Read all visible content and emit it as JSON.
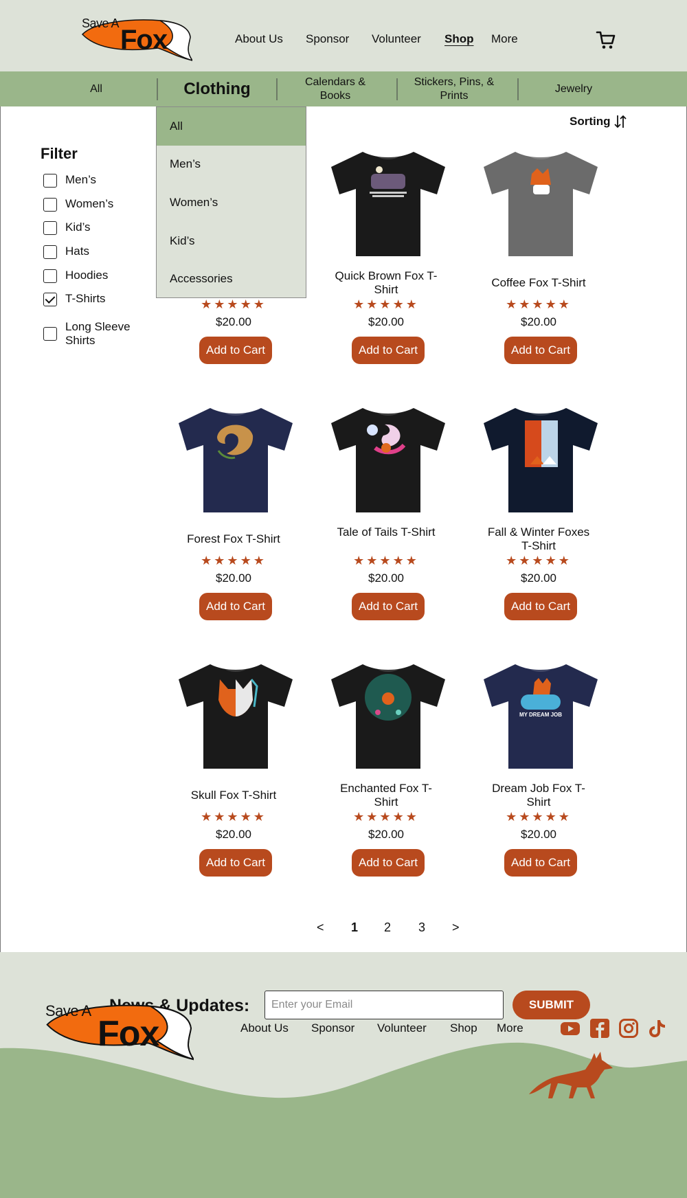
{
  "brand": {
    "top": "Save A",
    "main": "Fox"
  },
  "nav": [
    {
      "label": "About Us"
    },
    {
      "label": "Sponsor"
    },
    {
      "label": "Volunteer"
    },
    {
      "label": "Shop",
      "active": true
    },
    {
      "label": "More"
    }
  ],
  "categories": [
    {
      "label": "All"
    },
    {
      "label": "Clothing"
    },
    {
      "label": "Calendars & Books"
    },
    {
      "label": "Stickers, Pins, & Prints"
    },
    {
      "label": "Jewelry"
    }
  ],
  "dropdown": {
    "items": [
      {
        "label": "All",
        "selected": true
      },
      {
        "label": "Men’s"
      },
      {
        "label": "Women’s"
      },
      {
        "label": "Kid’s"
      },
      {
        "label": "Accessories"
      }
    ]
  },
  "filter": {
    "title": "Filter",
    "options": [
      {
        "label": "Men’s",
        "checked": false
      },
      {
        "label": "Women’s",
        "checked": false
      },
      {
        "label": "Kid’s",
        "checked": false
      },
      {
        "label": "Hats",
        "checked": false
      },
      {
        "label": "Hoodies",
        "checked": false
      },
      {
        "label": "T-Shirts",
        "checked": true
      },
      {
        "label": "Long Sleeve Shirts",
        "checked": false
      }
    ]
  },
  "sorting": {
    "label": "Sorting"
  },
  "products": [
    {
      "name": "",
      "stars": "★★★★★",
      "rating": 5,
      "price": "$20.00",
      "button": "Add to Cart",
      "shirt_color": "#1a1a1a"
    },
    {
      "name": "Quick Brown Fox T-Shirt",
      "stars": "★★★★★",
      "rating": 5,
      "price": "$20.00",
      "button": "Add to Cart",
      "shirt_color": "#1a1a1a"
    },
    {
      "name": "Coffee Fox T-Shirt",
      "stars": "★★★★★",
      "rating": 5,
      "price": "$20.00",
      "button": "Add to Cart",
      "shirt_color": "#6b6b6b"
    },
    {
      "name": "Forest Fox T-Shirt",
      "stars": "★★★★★",
      "rating": 5,
      "price": "$20.00",
      "button": "Add to Cart",
      "shirt_color": "#232a4e"
    },
    {
      "name": "Tale of Tails T-Shirt",
      "stars": "★★★★★",
      "rating": 5,
      "price": "$20.00",
      "button": "Add to Cart",
      "shirt_color": "#1a1a1a"
    },
    {
      "name": "Fall & Winter Foxes T-Shirt",
      "stars": "★★★★★",
      "rating": 5,
      "price": "$20.00",
      "button": "Add to Cart",
      "shirt_color": "#101a2e"
    },
    {
      "name": "Skull Fox T-Shirt",
      "stars": "★★★★★",
      "rating": 5,
      "price": "$20.00",
      "button": "Add to Cart",
      "shirt_color": "#1a1a1a"
    },
    {
      "name": "Enchanted Fox T-Shirt",
      "stars": "★★★★★",
      "rating": 5,
      "price": "$20.00",
      "button": "Add to Cart",
      "shirt_color": "#1a1a1a"
    },
    {
      "name": "Dream Job Fox T-Shirt",
      "stars": "★★★★★",
      "rating": 5,
      "price": "$20.00",
      "button": "Add to Cart",
      "shirt_color": "#232a4e"
    }
  ],
  "shirt_print_text": "MY DREAM JOB",
  "pagination": {
    "prev": "<",
    "pages": [
      "1",
      "2",
      "3"
    ],
    "current": "1",
    "next": ">"
  },
  "newsletter": {
    "label": "News & Updates:",
    "placeholder": "Enter your Email",
    "button": "SUBMIT"
  },
  "footer_nav": [
    {
      "label": "About Us"
    },
    {
      "label": "Sponsor"
    },
    {
      "label": "Volunteer"
    },
    {
      "label": "Shop"
    },
    {
      "label": "More"
    }
  ],
  "social": [
    "youtube-icon",
    "facebook-icon",
    "instagram-icon",
    "tiktok-icon"
  ],
  "colors": {
    "header_bg": "#dde2d8",
    "green": "#9ab68a",
    "accent": "#b84a1e",
    "logo_orange": "#f26b0f"
  }
}
